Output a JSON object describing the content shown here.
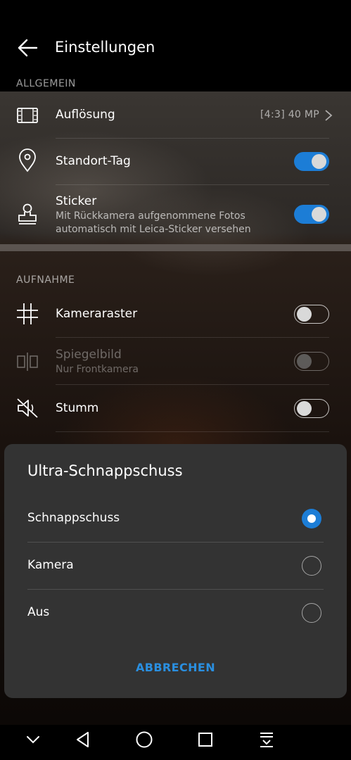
{
  "header": {
    "title": "Einstellungen"
  },
  "sections": {
    "general": "ALLGEMEIN",
    "capture": "AUFNAHME"
  },
  "settings": {
    "resolution": {
      "label": "Auflösung",
      "value": "[4:3] 40 MP"
    },
    "location_tag": {
      "label": "Standort-Tag",
      "enabled": true
    },
    "sticker": {
      "label": "Sticker",
      "sub1": "Mit Rückkamera aufgenommene Fotos",
      "sub2": "automatisch mit Leica-Sticker versehen",
      "enabled": true
    },
    "grid": {
      "label": "Kameraraster",
      "enabled": false
    },
    "mirror": {
      "label": "Spiegelbild",
      "sub": "Nur Frontkamera",
      "enabled": false,
      "disabled": true
    },
    "mute": {
      "label": "Stumm",
      "enabled": false
    }
  },
  "dialog": {
    "title": "Ultra-Schnappschuss",
    "options": [
      {
        "label": "Schnappschuss",
        "selected": true
      },
      {
        "label": "Kamera",
        "selected": false
      },
      {
        "label": "Aus",
        "selected": false
      }
    ],
    "cancel": "ABBRECHEN"
  },
  "colors": {
    "accent": "#1c7dd6",
    "dialog_bg": "#333333"
  },
  "nav_icons": [
    "chevron-down-icon",
    "back-triangle-icon",
    "home-circle-icon",
    "recents-square-icon",
    "notification-pull-icon"
  ]
}
